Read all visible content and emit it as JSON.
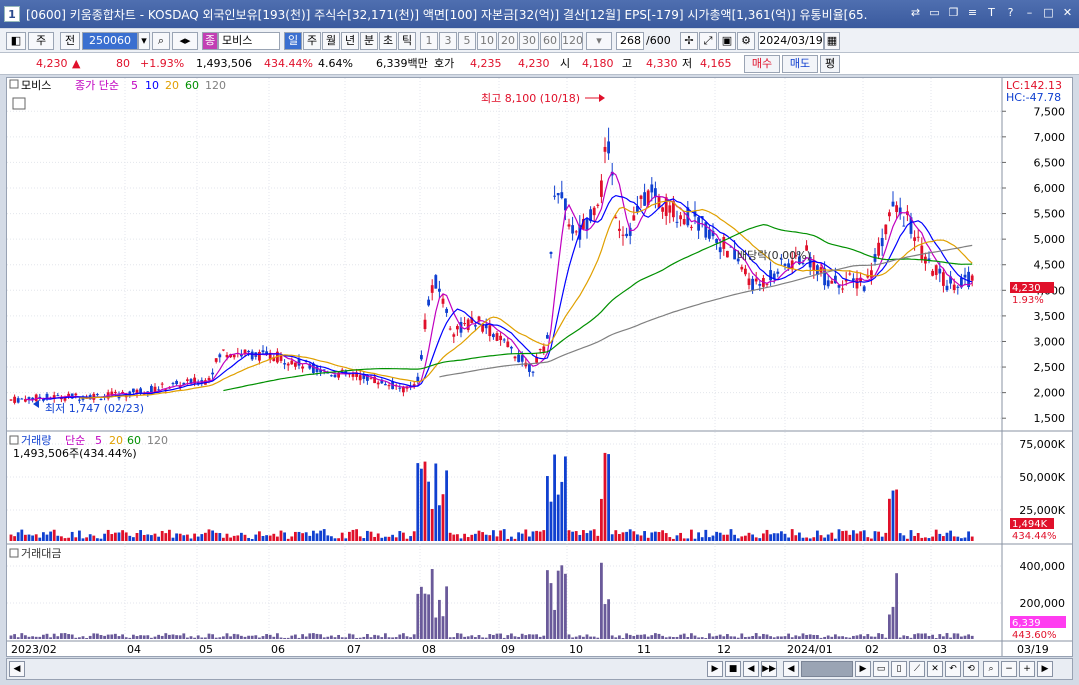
{
  "window": {
    "number": "1",
    "title": "[0600] 키움종합차트 - KOSDAQ 외국인보유[193(천)] 주식수[32,171(천)] 액면[100] 자본금[32(억)] 결산[12월] EPS[-179] 시가총액[1,361(억)] 유통비율[65."
  },
  "toolbar": {
    "period_buttons": [
      "주",
      "전"
    ],
    "code": "250060",
    "stock_name_prefix": "종",
    "stock_name": "모비스",
    "timeframes": [
      "일",
      "주",
      "월",
      "년",
      "분",
      "초",
      "틱"
    ],
    "active_timeframe": "일",
    "intervals": [
      "1",
      "3",
      "5",
      "10",
      "20",
      "30",
      "60",
      "120"
    ],
    "count": "268",
    "count_max": "/600",
    "date": "2024/03/19"
  },
  "quote": {
    "price": "4,230",
    "arrow": "▲",
    "change": "80",
    "change_pct": "+1.93%",
    "volume": "1,493,506",
    "volume_pct": "434.44%",
    "turnover": "4.64%",
    "amount": "6,339백만",
    "ask_label": "호가",
    "ask": "4,235",
    "bid": "4,230",
    "open_label": "시",
    "open": "4,180",
    "high_label": "고",
    "high": "4,330",
    "low_label": "저",
    "low": "4,165",
    "buy_label": "매수",
    "sell_label": "매도",
    "eval_label": "평"
  },
  "chart": {
    "stock_label": "모비스",
    "legend_title": "종가 단순",
    "ma_periods": [
      "5",
      "10",
      "20",
      "60",
      "120"
    ],
    "lc": "LC:142.13",
    "hc": "HC:-47.78",
    "high_annotation": "최고 8,100 (10/18)",
    "low_annotation": "최저 1,747 (02/23)",
    "dividend_annotation": "배당락(0.00%)",
    "price_ticks": [
      "7,500",
      "7,000",
      "6,500",
      "6,000",
      "5,500",
      "5,000",
      "4,500",
      "4,000",
      "3,500",
      "3,000",
      "2,500",
      "2,000",
      "1,500"
    ],
    "current_price": "4,230",
    "current_pct": "1.93%",
    "volume_title": "거래량",
    "volume_legend": "단순",
    "volume_ma": [
      "5",
      "20",
      "60",
      "120"
    ],
    "volume_value": "1,493,506주(434.44%)",
    "volume_ticks": [
      "75,000K",
      "50,000K",
      "25,000K"
    ],
    "volume_current": "1,494K",
    "volume_pct": "434.44%",
    "amount_title": "거래대금",
    "amount_ticks": [
      "400,000",
      "200,000"
    ],
    "amount_current": "6,339",
    "amount_pct": "443.60%",
    "x_labels": [
      "2023/02",
      "04",
      "05",
      "06",
      "07",
      "08",
      "09",
      "10",
      "11",
      "12",
      "2024/01",
      "02",
      "03"
    ],
    "last_date": "03/19"
  },
  "colors": {
    "up": "#e0102a",
    "down": "#1040d0",
    "ma5": "#c000c0",
    "ma10": "#0000ff",
    "ma20": "#e0a000",
    "ma60": "#009000",
    "ma120": "#808080",
    "amount_bar": "#6a5a9a"
  }
}
